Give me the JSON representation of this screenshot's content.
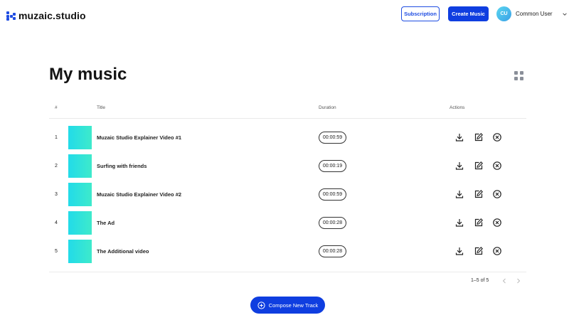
{
  "brand": {
    "name": "muzaic.studio",
    "color": "#1f4de2"
  },
  "header": {
    "subscription_label": "Subscription",
    "create_label": "Create Music",
    "user_initials": "CU",
    "user_name": "Common User"
  },
  "page": {
    "title": "My music"
  },
  "table": {
    "columns": {
      "num": "#",
      "title": "Title",
      "duration": "Duration",
      "actions": "Actions"
    },
    "rows": [
      {
        "num": "1",
        "title": "Muzaic Studio Explainer Video #1",
        "duration": "00:00:59"
      },
      {
        "num": "2",
        "title": "Surfing with friends",
        "duration": "00:00:19"
      },
      {
        "num": "3",
        "title": "Muzaic Studio Explainer Video #2",
        "duration": "00:00:59"
      },
      {
        "num": "4",
        "title": "The Ad",
        "duration": "00:00:28"
      },
      {
        "num": "5",
        "title": "The Additional video",
        "duration": "00:00:28"
      }
    ],
    "actions": [
      "download-icon",
      "edit-icon",
      "delete-icon"
    ]
  },
  "pagination": {
    "range_text": "1–5 of 5"
  },
  "compose": {
    "label": "Compose New Track"
  }
}
